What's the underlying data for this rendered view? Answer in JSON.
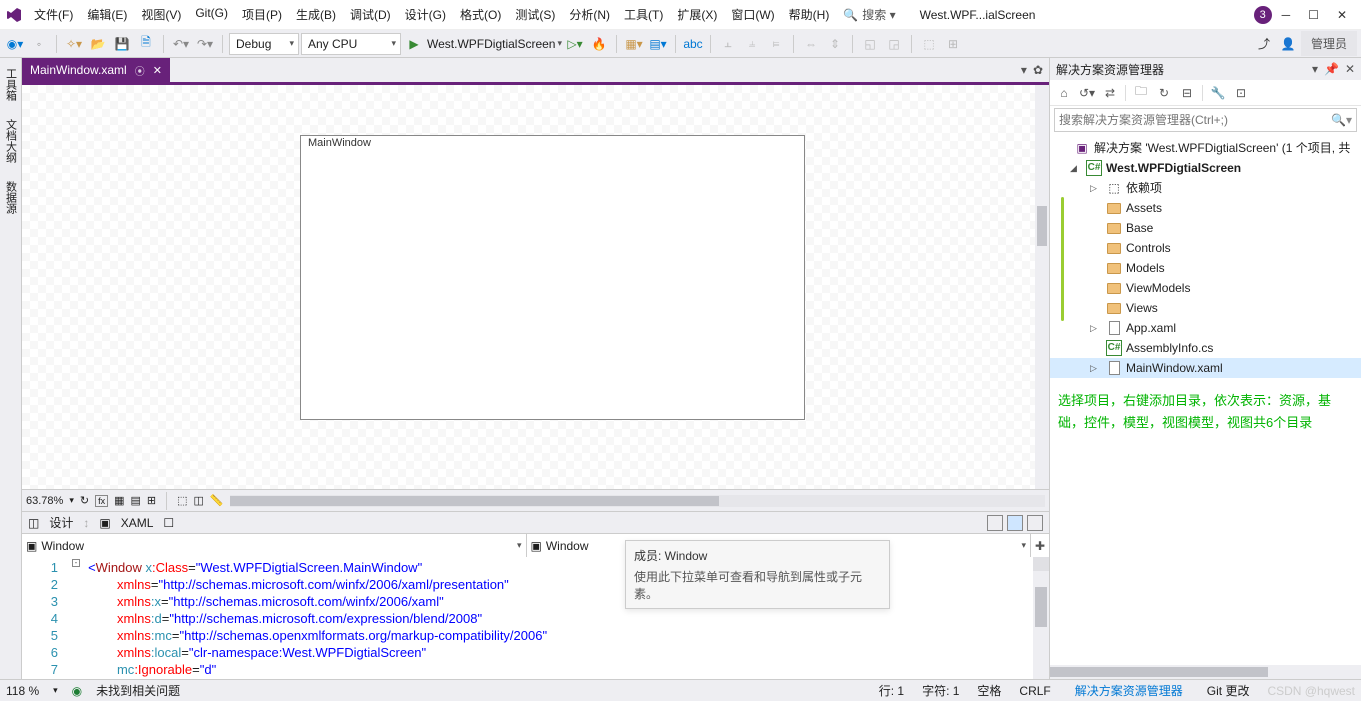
{
  "menubar": [
    "文件(F)",
    "编辑(E)",
    "视图(V)",
    "Git(G)",
    "项目(P)",
    "生成(B)",
    "调试(D)",
    "设计(G)",
    "格式(O)",
    "测试(S)",
    "分析(N)",
    "工具(T)",
    "扩展(X)",
    "窗口(W)",
    "帮助(H)"
  ],
  "title_search": "搜索 ▾",
  "title_doc": "West.WPF...ialScreen",
  "title_badge": "3",
  "toolbar": {
    "config": "Debug",
    "platform": "Any CPU",
    "start_target": "West.WPFDigtialScreen",
    "admin": "管理员"
  },
  "side_tabs": [
    "工具箱",
    "文档大纲",
    "数据源"
  ],
  "doc_tab": "MainWindow.xaml",
  "designer_win_title": "MainWindow",
  "zoom": "63.78%",
  "split": {
    "design": "设计",
    "xaml": "XAML"
  },
  "nav_left": "Window",
  "nav_right": "Window",
  "code_lines": [
    "1",
    "2",
    "3",
    "4",
    "5",
    "6",
    "7"
  ],
  "tooltip": {
    "t1": "成员: Window",
    "t2": "使用此下拉菜单可查看和导航到属性或子元素。"
  },
  "solution": {
    "title": "解决方案资源管理器",
    "search_placeholder": "搜索解决方案资源管理器(Ctrl+;)",
    "root": "解决方案 'West.WPFDigtialScreen' (1 个项目, 共",
    "project": "West.WPFDigtialScreen",
    "deps": "依赖项",
    "folders": [
      "Assets",
      "Base",
      "Controls",
      "Models",
      "ViewModels",
      "Views"
    ],
    "appxaml": "App.xaml",
    "asm": "AssemblyInfo.cs",
    "mainwin": "MainWindow.xaml"
  },
  "note": "选择项目，右键添加目录，依次表示：资源，基础，控件，模型，视图模型，视图共6个目录",
  "status": {
    "pct": "118 %",
    "issues": "未找到相关问题",
    "line": "行: 1",
    "col": "字符: 1",
    "spaces": "空格",
    "crlf": "CRLF",
    "tab1": "解决方案资源管理器",
    "tab2": "Git 更改",
    "watermark": "CSDN @hqwest"
  }
}
